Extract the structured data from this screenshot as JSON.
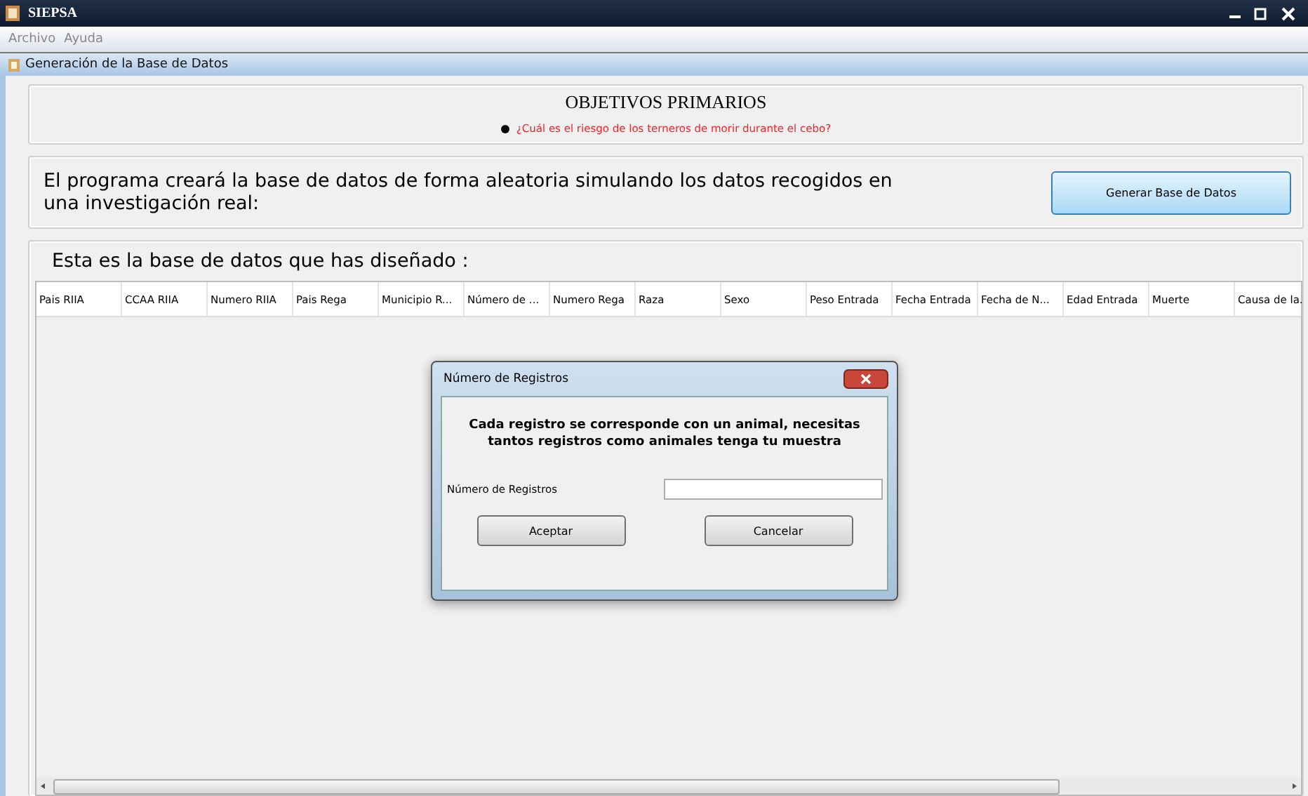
{
  "window": {
    "title": "SIEPSA"
  },
  "menu": [
    "Archivo",
    "Ayuda"
  ],
  "frame": {
    "title": "Generación de la Base de Datos"
  },
  "objectives": {
    "title": "OBJETIVOS PRIMARIOS",
    "items": [
      "¿Cuál es el riesgo de los terneros de morir durante el cebo?"
    ]
  },
  "description": {
    "text": "El programa creará la base de datos de forma aleatoria simulando los datos recogidos en una investigación real:",
    "button": "Generar Base de Datos"
  },
  "table": {
    "title": "Esta es la base de datos que has diseñado :",
    "columns": [
      "Pais RIIA",
      "CCAA RIIA",
      "Numero RIIA",
      "Pais Rega",
      "Municipio R...",
      "Número de ...",
      "Numero Rega",
      "Raza",
      "Sexo",
      "Peso Entrada",
      "Fecha Entrada",
      "Fecha de N...",
      "Edad Entrada",
      "Muerte",
      "Causa de la."
    ]
  },
  "dialog": {
    "title": "Número de Registros",
    "message": "Cada registro se corresponde con un animal, necesitas tantos registros como animales tenga tu muestra",
    "field_label": "Número de Registros",
    "buttons": [
      "Aceptar",
      "Cancelar"
    ]
  }
}
